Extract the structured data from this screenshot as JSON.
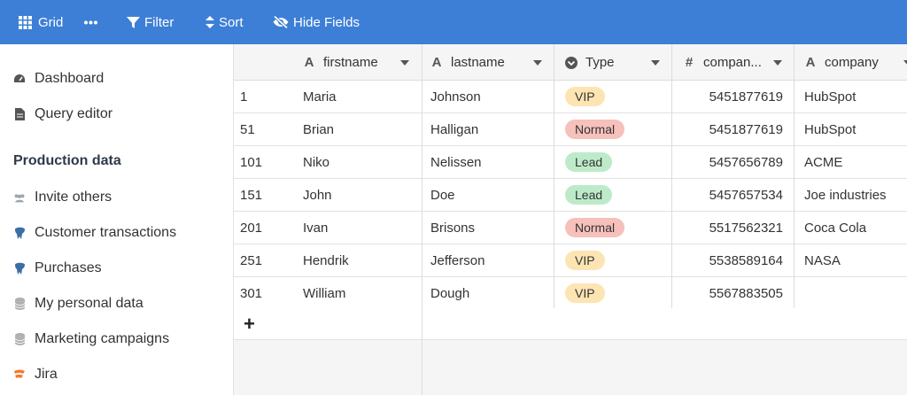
{
  "toolbar": {
    "grid_label": "Grid",
    "filter_label": "Filter",
    "sort_label": "Sort",
    "hide_fields_label": "Hide Fields"
  },
  "sidebar": {
    "items_top": [
      {
        "label": "Dashboard",
        "icon": "gauge-icon"
      },
      {
        "label": "Query editor",
        "icon": "document-icon"
      }
    ],
    "heading": "Production data",
    "items": [
      {
        "label": "Invite others",
        "icon": "people-icon"
      },
      {
        "label": "Customer transactions",
        "icon": "postgres-icon"
      },
      {
        "label": "Purchases",
        "icon": "postgres-icon"
      },
      {
        "label": "My personal data",
        "icon": "database-icon"
      },
      {
        "label": "Marketing campaigns",
        "icon": "database-icon"
      },
      {
        "label": "Jira",
        "icon": "jira-icon"
      }
    ]
  },
  "table": {
    "columns": [
      {
        "label": "firstname",
        "icon": "text-type-icon"
      },
      {
        "label": "lastname",
        "icon": "text-type-icon"
      },
      {
        "label": "Type",
        "icon": "select-type-icon"
      },
      {
        "label": "compan...",
        "icon": "number-type-icon"
      },
      {
        "label": "company",
        "icon": "text-type-icon"
      }
    ],
    "rows": [
      {
        "id": "1",
        "firstname": "Maria",
        "lastname": "Johnson",
        "type": "VIP",
        "phone": "5451877619",
        "company": "HubSpot"
      },
      {
        "id": "51",
        "firstname": "Brian",
        "lastname": "Halligan",
        "type": "Normal",
        "phone": "5451877619",
        "company": "HubSpot"
      },
      {
        "id": "101",
        "firstname": "Niko",
        "lastname": "Nelissen",
        "type": "Lead",
        "phone": "5457656789",
        "company": "ACME"
      },
      {
        "id": "151",
        "firstname": "John",
        "lastname": "Doe",
        "type": "Lead",
        "phone": "5457657534",
        "company": "Joe industries"
      },
      {
        "id": "201",
        "firstname": "Ivan",
        "lastname": "Brisons",
        "type": "Normal",
        "phone": "5517562321",
        "company": "Coca Cola"
      },
      {
        "id": "251",
        "firstname": "Hendrik",
        "lastname": "Jefferson",
        "type": "VIP",
        "phone": "5538589164",
        "company": "NASA"
      },
      {
        "id": "301",
        "firstname": "William",
        "lastname": "Dough",
        "type": "VIP",
        "phone": "5567883505",
        "company": ""
      }
    ],
    "add_row_label": "+"
  },
  "colors": {
    "toolbar_bg": "#3d7fd6",
    "badge_vip_bg": "#fde4b3",
    "badge_normal_bg": "#f6c0bb",
    "badge_lead_bg": "#bdebc9"
  }
}
